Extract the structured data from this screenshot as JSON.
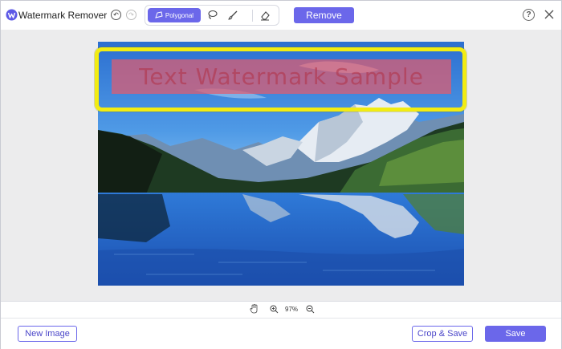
{
  "app": {
    "title": "Watermark Remover"
  },
  "toolbar": {
    "undo_icon": "undo-icon",
    "redo_icon": "redo-icon",
    "polygonal_label": "Polygonal",
    "polygonal_icon": "polygon-icon",
    "lasso_icon": "lasso-icon",
    "brush_icon": "brush-icon",
    "eraser_icon": "eraser-icon",
    "remove_label": "Remove",
    "help_icon": "help-icon",
    "help_glyph": "?",
    "close_icon": "close-icon"
  },
  "canvas": {
    "watermark_text": "Text Watermark Sample",
    "image_subject": "mountain lake landscape"
  },
  "zoom": {
    "hand_icon": "hand-pan-icon",
    "zoom_in_icon": "zoom-in-icon",
    "zoom_out_icon": "zoom-out-icon",
    "level": "97%"
  },
  "footer": {
    "new_image_label": "New Image",
    "crop_save_label": "Crop & Save",
    "save_label": "Save"
  },
  "colors": {
    "accent": "#6b67ea",
    "highlight": "#f2ec12",
    "selection": "#e25c6e"
  }
}
